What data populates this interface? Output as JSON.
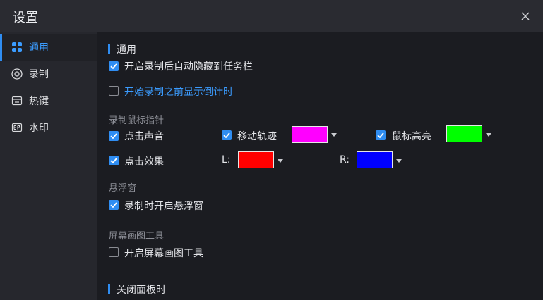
{
  "window": {
    "title": "设置",
    "close_icon": "close-icon"
  },
  "sidebar": {
    "items": [
      {
        "label": "通用",
        "icon": "grid-icon",
        "active": true
      },
      {
        "label": "录制",
        "icon": "record-icon",
        "active": false
      },
      {
        "label": "热键",
        "icon": "keyboard-icon",
        "active": false
      },
      {
        "label": "水印",
        "icon": "watermark-icon",
        "active": false
      }
    ]
  },
  "general": {
    "section_title": "通用",
    "auto_hide": {
      "label": "开启录制后自动隐藏到任务栏",
      "checked": true
    },
    "countdown": {
      "label": "开始录制之前显示倒计时",
      "checked": false
    }
  },
  "mouse": {
    "group_title": "录制鼠标指针",
    "click_sound": {
      "label": "点击声音",
      "checked": true
    },
    "move_track": {
      "label": "移动轨迹",
      "checked": true,
      "color": "#ff00ff"
    },
    "highlight": {
      "label": "鼠标高亮",
      "checked": true,
      "color": "#00ff00"
    },
    "click_effect": {
      "label": "点击效果",
      "checked": true
    },
    "left": {
      "label": "L:",
      "color": "#ff0000"
    },
    "right": {
      "label": "R:",
      "color": "#0000ff"
    }
  },
  "floating": {
    "group_title": "悬浮窗",
    "enable": {
      "label": "录制时开启悬浮窗",
      "checked": true
    }
  },
  "drawing": {
    "group_title": "屏幕画图工具",
    "enable": {
      "label": "开启屏幕画图工具",
      "checked": false
    }
  },
  "close_panel": {
    "section_title": "关闭面板时"
  },
  "colors": {
    "accent": "#2f8df2",
    "background": "#1b1c21",
    "sidebar": "#26272d",
    "titlebar": "#2a2b31"
  }
}
